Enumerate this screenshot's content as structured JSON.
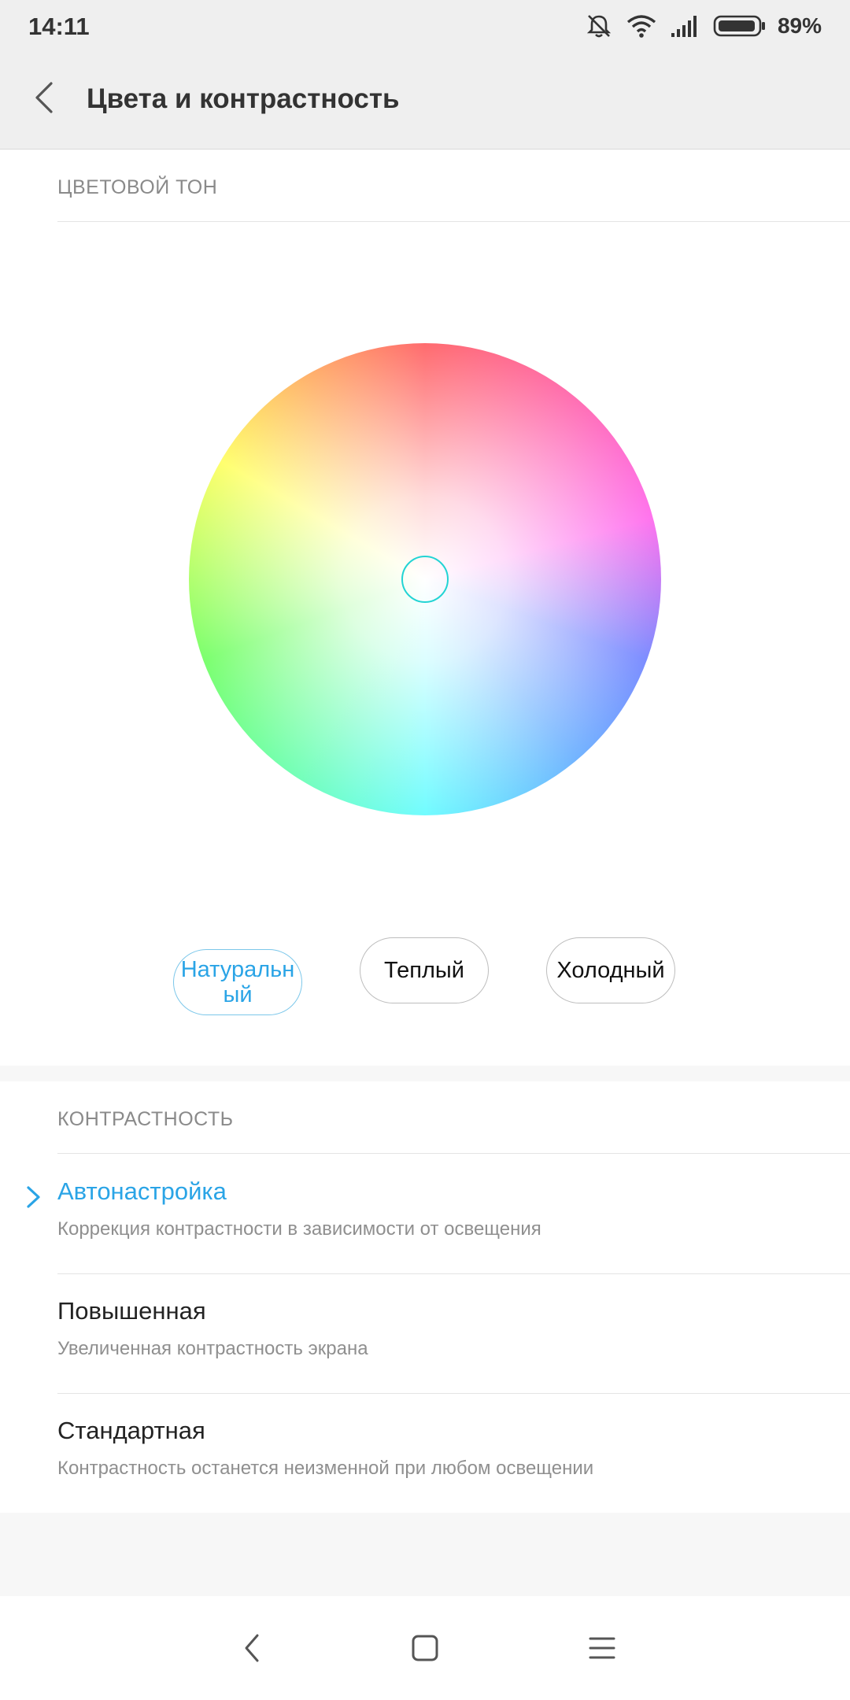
{
  "status_bar": {
    "time": "14:11",
    "battery_percent": "89%",
    "icons": [
      "alarm-muted-icon",
      "wifi-icon",
      "signal-icon",
      "battery-icon"
    ]
  },
  "header": {
    "title": "Цвета и контрастность",
    "back_icon": "chevron-left-icon"
  },
  "color_tone": {
    "section_title": "ЦВЕТОВОЙ ТОН",
    "presets": [
      {
        "label": "Натуральный",
        "selected": true
      },
      {
        "label": "Теплый",
        "selected": false
      },
      {
        "label": "Холодный",
        "selected": false
      }
    ]
  },
  "contrast": {
    "section_title": "КОНТРАСТНОСТЬ",
    "options": [
      {
        "title": "Автонастройка",
        "subtitle": "Коррекция контрастности в зависимости от освещения",
        "selected": true
      },
      {
        "title": "Повышенная",
        "subtitle": "Увеличенная контрастность экрана",
        "selected": false
      },
      {
        "title": "Стандартная",
        "subtitle": "Контрастность останется неизменной при любом освещении",
        "selected": false
      }
    ]
  },
  "navigation": {
    "icons": [
      "nav-back-icon",
      "nav-home-icon",
      "nav-menu-icon"
    ]
  },
  "colors": {
    "accent": "#2aa4e6",
    "handle": "#22d4d4",
    "background": "#f7f7f7"
  }
}
